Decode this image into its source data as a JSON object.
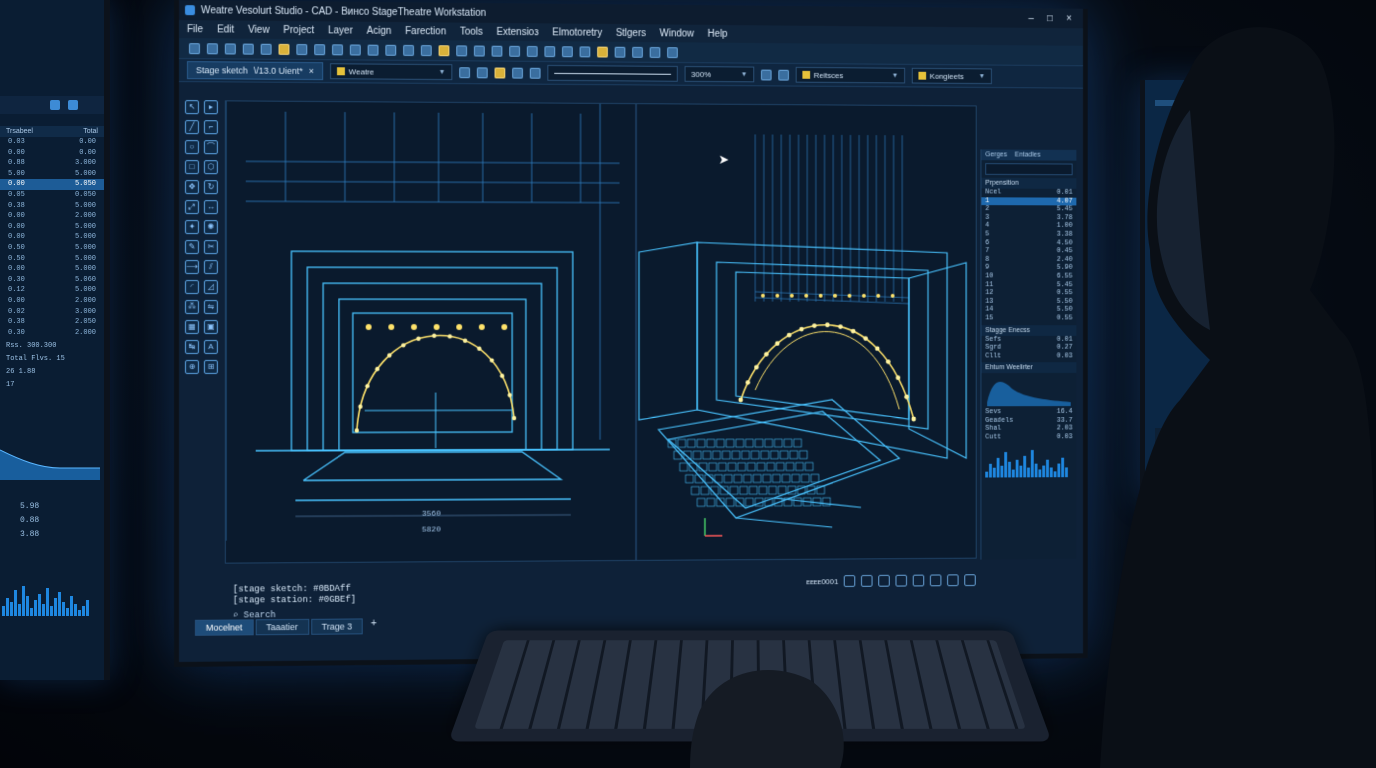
{
  "app": {
    "title": "Wеatre Vesolurt Studio - CAD - Bинco StageTheatre Workstation",
    "window_controls": [
      "–",
      "□",
      "×"
    ]
  },
  "menu": [
    "File",
    "Edit",
    "View",
    "Project",
    "Layer",
    "Acign",
    "Farection",
    "Tools",
    "Extensioз",
    "Elmotoretry",
    "Stlgers",
    "Window",
    "Help"
  ],
  "toolbar2": {
    "doc_tab": "Stage sketch",
    "doc_tab_suffix": "\\/13.0 Uient*",
    "style_dropdown": "Weatre",
    "zoom": "300%",
    "layer_dropdown": "Reitsces",
    "view_dropdown": "Kongieets"
  },
  "viewport": {
    "dim_top": "3560",
    "dim_bottom": "5820"
  },
  "right_panel": {
    "tabs": [
      "Gerges",
      "Entadles"
    ],
    "section1": "Prpensition",
    "rows1": [
      [
        "Ncel",
        "0.01"
      ],
      [
        "1",
        "4.07"
      ],
      [
        "2",
        "5.45"
      ],
      [
        "3",
        "3.78"
      ],
      [
        "4",
        "1.00"
      ],
      [
        "5",
        "3.38"
      ],
      [
        "6",
        "4.50"
      ],
      [
        "7",
        "0.45"
      ],
      [
        "8",
        "2.40"
      ],
      [
        "9",
        "5.90"
      ],
      [
        "10",
        "6.55"
      ],
      [
        "11",
        "5.45"
      ],
      [
        "12",
        "0.55"
      ],
      [
        "13",
        "5.50"
      ],
      [
        "14",
        "5.50"
      ],
      [
        "15",
        "0.55"
      ]
    ],
    "section2": "Stagge Enecss",
    "rows2": [
      [
        "Sefs",
        "0.01"
      ],
      [
        "Sgrd",
        "0.27"
      ],
      [
        "Cllt",
        "0.03"
      ]
    ],
    "section3": "Ehtum Weelirter",
    "rows3": [
      [
        "Sevs",
        "16.4"
      ],
      [
        "Geadels",
        "33.7"
      ],
      [
        "Shal",
        "2.03"
      ],
      [
        "Cutt",
        "0.03"
      ]
    ]
  },
  "command": {
    "line1": "[stage sketch: #0BDAff",
    "line2": "[stage station: #0GBEf]",
    "input_label": "Search"
  },
  "status": {
    "coord": "ᴇᴇᴇᴇ0001"
  },
  "layout_tabs": [
    "Mocelnet",
    "Taaatier",
    "Trage 3",
    "+"
  ],
  "left_monitor": {
    "head": [
      "Trsabeel",
      "Total"
    ],
    "rows": [
      [
        "0.03",
        "0.00"
      ],
      [
        "0.00",
        "0.00"
      ],
      [
        "0.88",
        "3.000"
      ],
      [
        "5.00",
        "5.000"
      ],
      [
        "0.00",
        "5.050"
      ],
      [
        "0.05",
        "0.050"
      ],
      [
        "0.38",
        "5.000"
      ],
      [
        "0.00",
        "2.000"
      ],
      [
        "0.00",
        "5.000"
      ],
      [
        "0.00",
        "5.000"
      ],
      [
        "0.50",
        "5.000"
      ],
      [
        "0.50",
        "5.000"
      ],
      [
        "0.00",
        "5.000"
      ],
      [
        "0.30",
        "5.060"
      ],
      [
        "0.12",
        "5.000"
      ],
      [
        "0.00",
        "2.000"
      ],
      [
        "0.02",
        "3.000"
      ],
      [
        "0.38",
        "2.050"
      ],
      [
        "0.30",
        "2.000"
      ]
    ],
    "summary": [
      "Rss. 300.300",
      "Total Flvs. 15",
      "26 1.88",
      "17"
    ],
    "stats": [
      "5.98",
      "0.88",
      "3.88"
    ]
  },
  "colors": {
    "accent": "#3ab6ff",
    "wire": "#49c3ff",
    "lights": "#ffe36b",
    "panel": "#0e2138",
    "selection": "#1e69ae"
  },
  "icons": [
    "app-icon",
    "pointer-icon",
    "line-icon",
    "circle-icon",
    "rect-icon",
    "move-icon",
    "rotate-icon",
    "scale-icon",
    "zoom-icon",
    "cursor-icon",
    "axis-icon"
  ]
}
